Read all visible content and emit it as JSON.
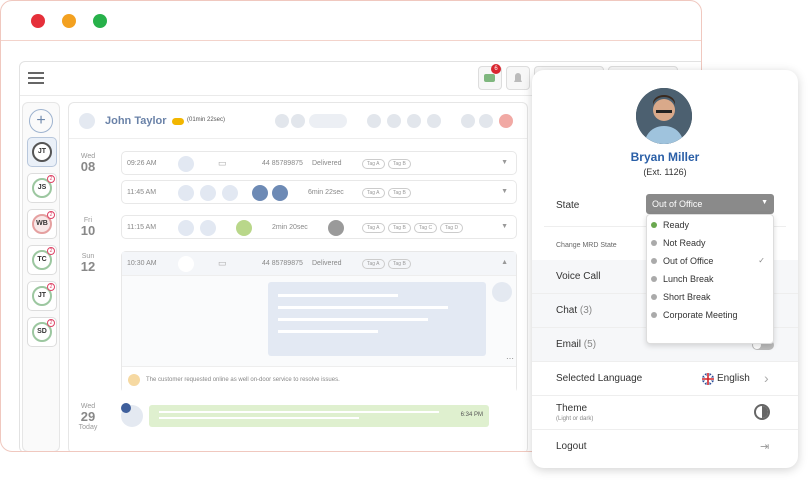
{
  "window": {
    "traffic_lights": [
      "#e5303a",
      "#f3a120",
      "#27b14a"
    ]
  },
  "toolbar": {
    "chat_badge": "6"
  },
  "sidebar": {
    "items": [
      {
        "initials": "JT",
        "badge": ""
      },
      {
        "initials": "JS",
        "badge": "2"
      },
      {
        "initials": "WB",
        "badge": "2"
      },
      {
        "initials": "TC",
        "badge": "2"
      },
      {
        "initials": "JT",
        "badge": "2"
      },
      {
        "initials": "SD",
        "badge": "2"
      }
    ]
  },
  "conversation": {
    "contact_name": "John Taylor",
    "timer": "(01min 22sec)",
    "days": [
      {
        "day": "Wed",
        "date": "08"
      },
      {
        "day": "Fri",
        "date": "10"
      },
      {
        "day": "Sun",
        "date": "12"
      },
      {
        "day": "Wed",
        "date": "29",
        "today": "Today"
      }
    ],
    "rows": [
      {
        "time": "09:26 AM",
        "phone": "44 85789875",
        "status": "Delivered",
        "tags": [
          "Tag A",
          "Tag B"
        ]
      },
      {
        "time": "11:45 AM",
        "duration": "6min 22sec",
        "tags": [
          "Tag A",
          "Tag B"
        ]
      },
      {
        "time": "11:15 AM",
        "duration": "2min 20sec",
        "tags": [
          "Tag A",
          "Tag B",
          "Tag C",
          "Tag D"
        ]
      },
      {
        "time": "10:30 AM",
        "phone": "44 85789875",
        "status": "Delivered",
        "tags": [
          "Tag A",
          "Tag B"
        ]
      }
    ],
    "note": "The customer requested online as well on-door service to resolve issues.",
    "last_message_time": "6:34 PM"
  },
  "profile": {
    "name": "Bryan Miller",
    "ext": "(Ext. 1126)",
    "state_label": "State",
    "state_value": "Out of Office",
    "change_mrd_label": "Change MRD State",
    "state_options": [
      {
        "label": "Ready",
        "color": "#6aa84f",
        "checked": false
      },
      {
        "label": "Not Ready",
        "color": "#aaaaaa",
        "checked": false
      },
      {
        "label": "Out of Office",
        "color": "#aaaaaa",
        "checked": true
      },
      {
        "label": "Lunch Break",
        "color": "#aaaaaa",
        "checked": false
      },
      {
        "label": "Short Break",
        "color": "#aaaaaa",
        "checked": false
      },
      {
        "label": "Corporate Meeting",
        "color": "#aaaaaa",
        "checked": false
      }
    ],
    "voice_call": "Voice Call",
    "chat": "Chat",
    "chat_count": "(3)",
    "email": "Email",
    "email_count": "(5)",
    "language_label": "Selected Language",
    "language_value": "English",
    "theme_label": "Theme",
    "theme_sub": "(Light or dark)",
    "logout": "Logout"
  }
}
